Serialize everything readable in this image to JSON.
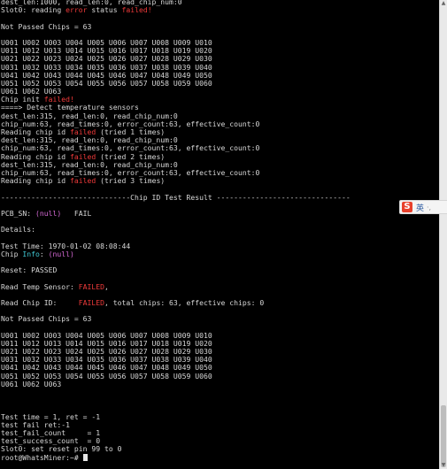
{
  "terminal": {
    "lines": [
      [
        {
          "t": "dest_len:1000, read_len:0, read_chip_num:0"
        }
      ],
      [
        {
          "t": "Slot0: reading "
        },
        {
          "t": "error",
          "c": "red"
        },
        {
          "t": " status "
        },
        {
          "t": "failed!",
          "c": "red"
        }
      ],
      [
        {
          "t": ""
        }
      ],
      [
        {
          "t": "Not Passed Chips = 63"
        }
      ],
      [
        {
          "t": ""
        }
      ],
      [
        {
          "t": "U001 U002 U003 U004 U005 U006 U007 U008 U009 U010"
        }
      ],
      [
        {
          "t": "U011 U012 U013 U014 U015 U016 U017 U018 U019 U020"
        }
      ],
      [
        {
          "t": "U021 U022 U023 U024 U025 U026 U027 U028 U029 U030"
        }
      ],
      [
        {
          "t": "U031 U032 U033 U034 U035 U036 U037 U038 U039 U040"
        }
      ],
      [
        {
          "t": "U041 U042 U043 U044 U045 U046 U047 U048 U049 U050"
        }
      ],
      [
        {
          "t": "U051 U052 U053 U054 U055 U056 U057 U058 U059 U060"
        }
      ],
      [
        {
          "t": "U061 U062 U063"
        }
      ],
      [
        {
          "t": "Chip init "
        },
        {
          "t": "failed!",
          "c": "red"
        }
      ],
      [
        {
          "t": "====> Detect temperature sensors"
        }
      ],
      [
        {
          "t": "dest_len:315, read_len:0, read_chip_num:0"
        }
      ],
      [
        {
          "t": "chip_num:63, read_times:0, error_count:63, effective_count:0"
        }
      ],
      [
        {
          "t": "Reading chip id "
        },
        {
          "t": "failed",
          "c": "red"
        },
        {
          "t": " (tried 1 times)"
        }
      ],
      [
        {
          "t": "dest_len:315, read_len:0, read_chip_num:0"
        }
      ],
      [
        {
          "t": "chip_num:63, read_times:0, error_count:63, effective_count:0"
        }
      ],
      [
        {
          "t": "Reading chip id "
        },
        {
          "t": "failed",
          "c": "red"
        },
        {
          "t": " (tried 2 times)"
        }
      ],
      [
        {
          "t": "dest_len:315, read_len:0, read_chip_num:0"
        }
      ],
      [
        {
          "t": "chip_num:63, read_times:0, error_count:63, effective_count:0"
        }
      ],
      [
        {
          "t": "Reading chip id "
        },
        {
          "t": "failed",
          "c": "red"
        },
        {
          "t": " (tried 3 times)"
        }
      ],
      [
        {
          "t": ""
        }
      ],
      [
        {
          "t": "------------------------------Chip ID Test Result -------------------------------"
        }
      ],
      [
        {
          "t": ""
        }
      ],
      [
        {
          "t": "PCB_SN: "
        },
        {
          "t": "(null)",
          "c": "magenta"
        },
        {
          "t": "   FAIL"
        }
      ],
      [
        {
          "t": ""
        }
      ],
      [
        {
          "t": "Details:"
        }
      ],
      [
        {
          "t": ""
        }
      ],
      [
        {
          "t": "Test Time: 1970-01-02 08:08:44"
        }
      ],
      [
        {
          "t": "Chip "
        },
        {
          "t": "Info",
          "c": "cyan"
        },
        {
          "t": ": "
        },
        {
          "t": "(null)",
          "c": "magenta"
        }
      ],
      [
        {
          "t": ""
        }
      ],
      [
        {
          "t": "Reset: PASSED"
        }
      ],
      [
        {
          "t": ""
        }
      ],
      [
        {
          "t": "Read Temp Sensor: "
        },
        {
          "t": "FAILED",
          "c": "red"
        },
        {
          "t": ","
        }
      ],
      [
        {
          "t": ""
        }
      ],
      [
        {
          "t": "Read Chip ID:     "
        },
        {
          "t": "FAILED",
          "c": "red"
        },
        {
          "t": ", total chips: 63, effective chips: 0"
        }
      ],
      [
        {
          "t": ""
        }
      ],
      [
        {
          "t": "Not Passed Chips = 63"
        }
      ],
      [
        {
          "t": ""
        }
      ],
      [
        {
          "t": "U001 U002 U003 U004 U005 U006 U007 U008 U009 U010"
        }
      ],
      [
        {
          "t": "U011 U012 U013 U014 U015 U016 U017 U018 U019 U020"
        }
      ],
      [
        {
          "t": "U021 U022 U023 U024 U025 U026 U027 U028 U029 U030"
        }
      ],
      [
        {
          "t": "U031 U032 U033 U034 U035 U036 U037 U038 U039 U040"
        }
      ],
      [
        {
          "t": "U041 U042 U043 U044 U045 U046 U047 U048 U049 U050"
        }
      ],
      [
        {
          "t": "U051 U052 U053 U054 U055 U056 U057 U058 U059 U060"
        }
      ],
      [
        {
          "t": "U061 U062 U063"
        }
      ],
      [
        {
          "t": ""
        }
      ],
      [
        {
          "t": ""
        }
      ],
      [
        {
          "t": ""
        }
      ],
      [
        {
          "t": "Test time = 1, ret = -1"
        }
      ],
      [
        {
          "t": "test fail ret:-1"
        }
      ],
      [
        {
          "t": "test_fail_count     = 1"
        }
      ],
      [
        {
          "t": "test_success_count  = 0"
        }
      ],
      [
        {
          "t": "Slot0: set reset pin 99 to 0"
        }
      ],
      [
        {
          "t": "root@WhatsMiner:~# "
        },
        {
          "cursor": true
        }
      ]
    ]
  },
  "scrollbar": {
    "up_icon": "▲",
    "down_icon": "▼"
  },
  "ime": {
    "logo": "S",
    "lang": "英",
    "more": "·,"
  },
  "colors": {
    "background": "#000000",
    "text": "#d8d8d8",
    "red": "#ef3a3a",
    "magenta": "#d66ad6",
    "cyan": "#3fc7d2"
  }
}
